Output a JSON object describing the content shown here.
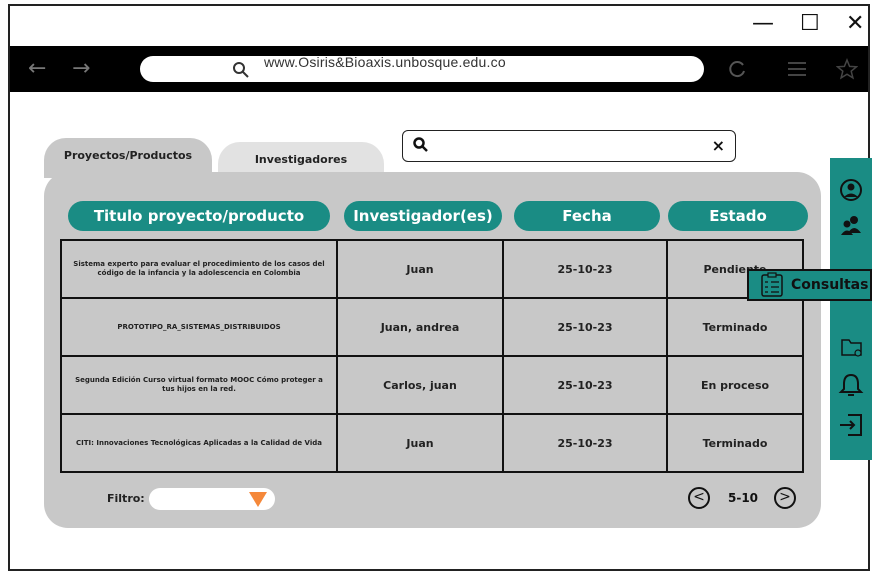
{
  "window": {
    "minimize": "—",
    "maximize": "☐",
    "close": "✕"
  },
  "browser": {
    "url": "www.Osiris&Bioaxis.unbosque.edu.co",
    "back": "←",
    "forward": "→"
  },
  "tabs": [
    {
      "label": "Proyectos/Productos"
    },
    {
      "label": "Investigadores"
    }
  ],
  "search": {
    "clear": "×"
  },
  "table": {
    "headers": [
      "Titulo proyecto/producto",
      "Investigador(es)",
      "Fecha",
      "Estado"
    ],
    "rows": [
      {
        "title": "Sistema experto para evaluar el procedimiento de los casos del código de la infancia y la adolescencia en Colombia",
        "investigators": "Juan",
        "date": "25-10-23",
        "status": "Pendiente"
      },
      {
        "title": "PROTOTIPO_RA_SISTEMAS_DISTRIBUIDOS",
        "investigators": "Juan, andrea",
        "date": "25-10-23",
        "status": "Terminado"
      },
      {
        "title": "Segunda Edición Curso virtual formato MOOC Cómo proteger a tus hijos en la red.",
        "investigators": "Carlos, juan",
        "date": "25-10-23",
        "status": "En proceso"
      },
      {
        "title": "CITI: Innovaciones Tecnológicas Aplicadas a la Calidad de Vida",
        "investigators": "Juan",
        "date": "25-10-23",
        "status": "Terminado"
      }
    ]
  },
  "filter": {
    "label": "Filtro:"
  },
  "pagination": {
    "range": "5-10",
    "prev": "<",
    "next": ">"
  },
  "sidebar": {
    "consultas_label": "Consultas"
  },
  "colors": {
    "accent": "#1a8c84",
    "panel": "#c8c8c8",
    "filter_arrow": "#f5883a"
  }
}
